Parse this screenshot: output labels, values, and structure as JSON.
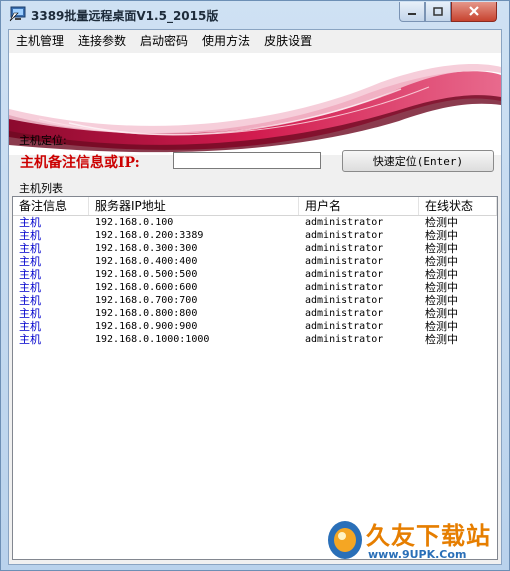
{
  "window": {
    "title": "3389批量远程桌面V1.5_2015版"
  },
  "menu": [
    "主机管理",
    "连接参数",
    "启动密码",
    "使用方法",
    "皮肤设置"
  ],
  "locate": {
    "section_label": "主机定位:",
    "search_label": "主机备注信息或IP:",
    "search_value": "",
    "button_label": "快速定位(Enter)"
  },
  "host_list": {
    "caption": "主机列表",
    "columns": [
      "备注信息",
      "服务器IP地址",
      "用户名",
      "在线状态"
    ],
    "rows": [
      [
        "主机",
        "192.168.0.100",
        "administrator",
        "检测中"
      ],
      [
        "主机",
        "192.168.0.200:3389",
        "administrator",
        "检测中"
      ],
      [
        "主机",
        "192.168.0.300:300",
        "administrator",
        "检测中"
      ],
      [
        "主机",
        "192.168.0.400:400",
        "administrator",
        "检测中"
      ],
      [
        "主机",
        "192.168.0.500:500",
        "administrator",
        "检测中"
      ],
      [
        "主机",
        "192.168.0.600:600",
        "administrator",
        "检测中"
      ],
      [
        "主机",
        "192.168.0.700:700",
        "administrator",
        "检测中"
      ],
      [
        "主机",
        "192.168.0.800:800",
        "administrator",
        "检测中"
      ],
      [
        "主机",
        "192.168.0.900:900",
        "administrator",
        "检测中"
      ],
      [
        "主机",
        "192.168.0.1000:1000",
        "administrator",
        "检测中"
      ]
    ]
  },
  "watermark": {
    "name": "久友下载站",
    "url": "www.9UPK.Com"
  },
  "colors": {
    "accent_red": "#cc0000",
    "note_blue": "#0000cc"
  },
  "icons": {
    "app": "remote-desktop-icon",
    "minimize": "minimize-icon",
    "maximize": "maximize-icon",
    "close": "close-icon"
  }
}
